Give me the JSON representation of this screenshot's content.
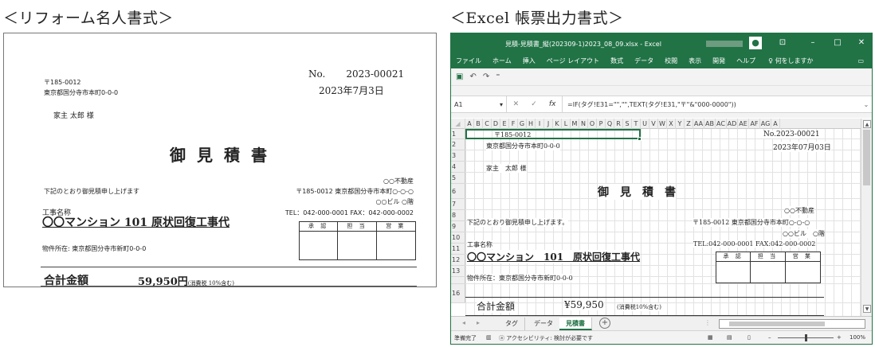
{
  "headings": {
    "left": "＜リフォーム名人書式＞",
    "right": "＜Excel 帳票出力書式＞"
  },
  "paper": {
    "postal": "〒185-0012",
    "address": "東京都国分寺市本町0-0-0",
    "customer": "家主  太郎 様",
    "no_label": "No.",
    "no_value": "2023-00021",
    "date": "2023年7月3日",
    "title": "御見積書",
    "company": "○○不動産",
    "company_address": "〒185-0012 東京都国分寺市本町○-○-○",
    "company_building": "○○ビル ○階",
    "company_tel": "TEL：042-000-0001 FAX：042-000-0002",
    "intro": "下記のとおり御見積申し上げます",
    "project_label": "工事名称",
    "project_name": "〇〇マンション 101 原状回復工事代",
    "site": "物件所在: 東京都国分寺市新町0-0-0",
    "stamps": [
      "承 認",
      "担 当",
      "営 業"
    ],
    "total_label": "合計金額",
    "total_value": "59,950円",
    "total_tax": "(消費税 10%含む)"
  },
  "excel": {
    "window_title": "見積-見積書_縦(202309-1)2023_08_09.xlsx  -  Excel",
    "ribbon_tabs": [
      "ファイル",
      "ホーム",
      "挿入",
      "ページ レイアウト",
      "数式",
      "データ",
      "校閲",
      "表示",
      "開発",
      "ヘルプ"
    ],
    "tell_me": "何をしますか",
    "name_box": "A1",
    "formula": "=IF(タグ!E31=\"\",\"\",TEXT(タグ!E31,\"〒\"&\"000-0000\"))",
    "columns": [
      "A",
      "B",
      "C",
      "D",
      "E",
      "F",
      "G",
      "H",
      "I",
      "J",
      "K",
      "L",
      "M",
      "N",
      "O",
      "P",
      "Q",
      "R",
      "S",
      "T",
      "U",
      "V",
      "W",
      "X",
      "Y",
      "Z",
      "AA",
      "AB",
      "AC",
      "AD",
      "AE",
      "AF",
      "AG",
      "A"
    ],
    "rows": [
      "1",
      "2",
      "3",
      "4",
      "5",
      "6",
      "7",
      "8",
      "9",
      "10",
      "11",
      "12",
      "13",
      "",
      "16"
    ],
    "cells": {
      "postal": "〒185-0012",
      "address": "東京都国分寺市本町0-0-0",
      "no": "No.2023-00021",
      "date": "2023年07月03日",
      "customer": "家主　太郎 様",
      "title": "御　見　積　書",
      "company": "○○不動産",
      "intro": "下記のとおり御見積申し上げます。",
      "company_address": "〒185-0012 東京都国分寺市本町○-○-○",
      "company_building": "○○ビル　○階",
      "project_label": "工事名称",
      "company_tel": "TEL:042-000-0001 FAX:042-000-0002",
      "project_name": "〇〇マンション　101　原状回復工事代",
      "site": "物件所在：東京都国分寺市新町0-0-0",
      "total_label": "合計金額",
      "total_value": "¥59,950",
      "total_tax": "(消費税10%含む)"
    },
    "stamps": [
      "承 認",
      "担 当",
      "営 業"
    ],
    "sheet_tabs": [
      "タグ",
      "データ",
      "見積書"
    ],
    "active_tab": "見積書",
    "status_ready": "準備完了",
    "status_accessibility": "アクセシビリティ: 検討が必要です",
    "zoom": "100%"
  }
}
